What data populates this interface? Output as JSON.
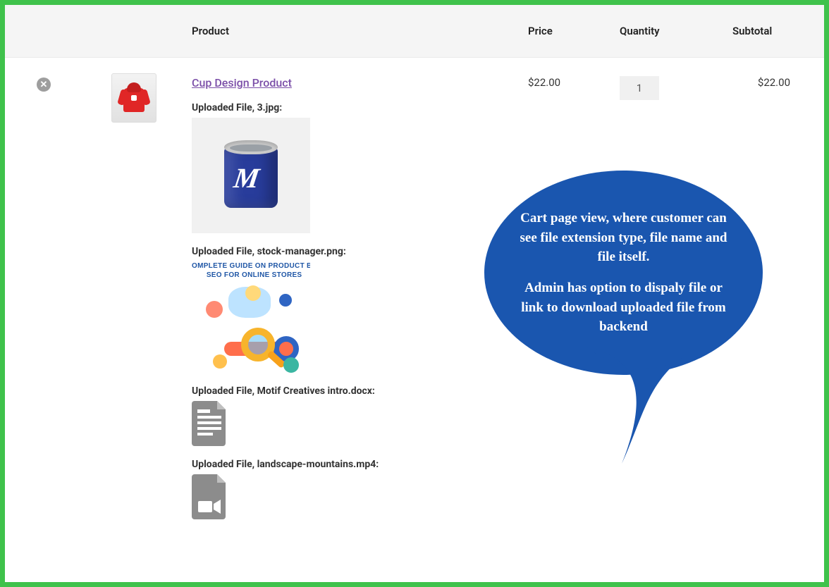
{
  "headers": {
    "product": "Product",
    "price": "Price",
    "quantity": "Quantity",
    "subtotal": "Subtotal"
  },
  "row": {
    "product_name": "Cup Design Product",
    "price": "$22.00",
    "quantity": "1",
    "subtotal": "$22.00",
    "preview2_title": "OMPLETE GUIDE ON PRODUCT BA\n   SEO FOR ONLINE STORES",
    "files": [
      {
        "label": "Uploaded File, 3.jpg:"
      },
      {
        "label": "Uploaded File, stock-manager.png:"
      },
      {
        "label": "Uploaded File, Motif Creatives intro.docx:"
      },
      {
        "label": "Uploaded File, landscape-mountains.mp4:"
      }
    ]
  },
  "callout": {
    "p1": "Cart page view, where customer can see file extension type, file name and file itself.",
    "p2": "Admin has option to dispaly file or link to download uploaded file from backend"
  }
}
